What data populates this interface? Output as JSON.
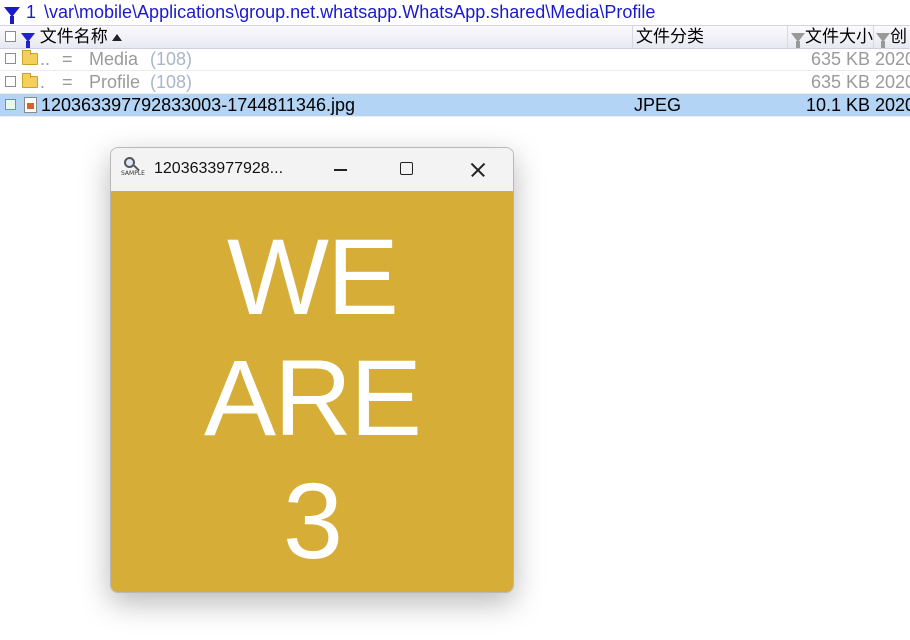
{
  "pathbar": {
    "number": "1",
    "path": "\\var\\mobile\\Applications\\group.net.whatsapp.WhatsApp.shared\\Media\\Profile"
  },
  "columns": {
    "name": "文件名称",
    "type": "文件分类",
    "size": "文件大小",
    "created": "创"
  },
  "rows": [
    {
      "dots": "..",
      "eq": "=",
      "name": "Media",
      "count": "(108)",
      "type": "",
      "size": "635 KB",
      "date": "2020"
    },
    {
      "dots": ".",
      "eq": "=",
      "name": "Profile",
      "count": "(108)",
      "type": "",
      "size": "635 KB",
      "date": "2020"
    },
    {
      "name": "120363397792833003-1744811346.jpg",
      "type": "JPEG",
      "size": "10.1 KB",
      "date": "2020"
    }
  ],
  "viewer": {
    "icon_label": "SAMPLE",
    "title": "1203633977928...",
    "image_text": [
      "WE",
      "ARE",
      "3"
    ],
    "image_bg": "#d6ad36"
  },
  "colors": {
    "path_blue": "#1a1acd",
    "selection": "#b3d4f5",
    "muted_text": "#9a9a9a"
  }
}
